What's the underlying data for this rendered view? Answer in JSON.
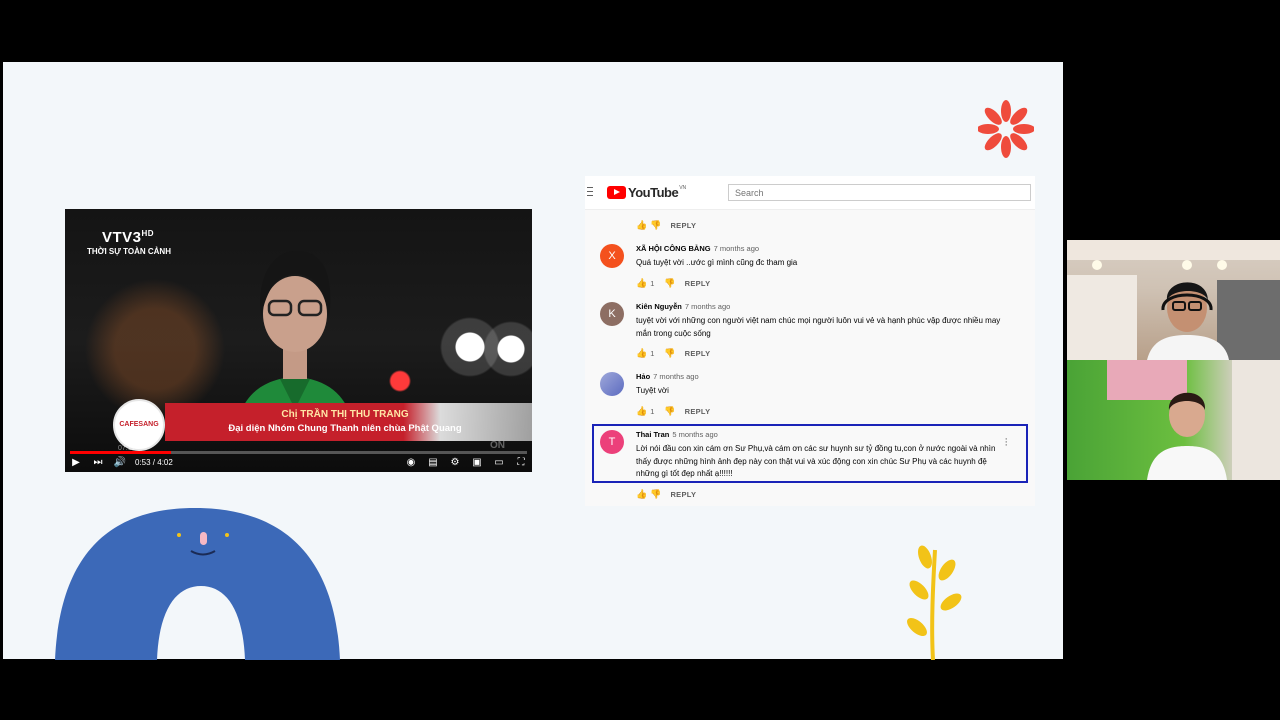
{
  "video": {
    "channel_logo": "VTV3",
    "channel_hd": "HD",
    "program": "THỜI SỰ TOÀN CẢNH",
    "lower_third_name": "Chị TRẦN THỊ THU TRANG",
    "lower_third_role": "Đại diện Nhóm Chung Thanh niên chùa Phật Quang",
    "badge": "CAFESANG",
    "watermark": "ON",
    "mini_time": "07:11",
    "time": "0:53 / 4:02",
    "progress": 0.22,
    "controls": [
      "play-icon",
      "next-icon",
      "volume-icon",
      "autoplay-toggle",
      "subtitles-icon",
      "settings-icon",
      "miniplayer-icon",
      "theater-icon",
      "fullscreen-icon"
    ]
  },
  "youtube": {
    "logo": "YouTube",
    "region": "VN",
    "search_placeholder": "Search",
    "reply_label": "REPLY",
    "comments": [
      {
        "author": "XÃ HỘI CÔNG BẰNG",
        "time": "7 months ago",
        "text": "Quá tuyệt vời ..ước gì mình cũng đc tham gia",
        "likes": "1",
        "avatar_letter": "X",
        "avatar_color": "#f4511e"
      },
      {
        "author": "Kiên Nguyễn",
        "time": "7 months ago",
        "text": "tuyệt vời với những con người việt nam chúc mọi người luôn vui vẻ và hạnh phúc vập được nhiều may mắn trong cuộc sống",
        "likes": "1",
        "avatar_letter": "K",
        "avatar_color": "#8d6e63"
      },
      {
        "author": "Hảo",
        "time": "7 months ago",
        "text": "Tuyệt vời",
        "likes": "1",
        "avatar_letter": "",
        "avatar_color": "#7986cb"
      },
      {
        "author": "Thai Tran",
        "time": "5 months ago",
        "text": "Lời nói đầu con xin cám ơn Sư Phụ,và cám ơn các sư huynh sư tỷ đồng tu,con ở nước ngoài và nhìn thấy được những hình ảnh đẹp này con thật vui và xúc động con xin chúc Sư Phụ và các huynh đệ những gì tốt đẹp nhất ạ!!!!!!",
        "likes": "",
        "avatar_letter": "T",
        "avatar_color": "#ec407a"
      }
    ]
  },
  "colors": {
    "highlight_border": "#1a23b8",
    "slide_bg": "#f3f7fa",
    "youtube_red": "#ff0000"
  }
}
